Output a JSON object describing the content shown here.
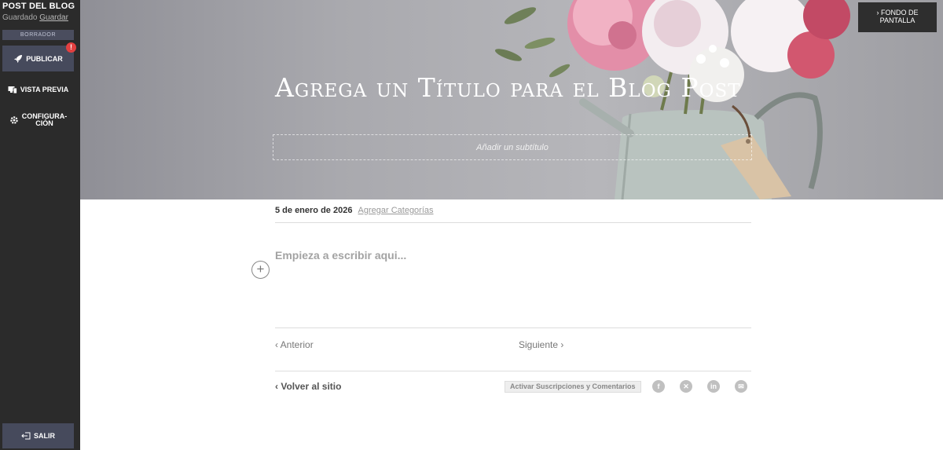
{
  "sidebar": {
    "title": "POST DEL BLOG",
    "saved_text": "Guardado",
    "save_link": "Guardar",
    "draft_label": "BORRADOR",
    "publish_label": "PUBLICAR",
    "publish_badge": "!",
    "preview_label": "VISTA PREVIA",
    "config_label_1": "CONFIGURA-",
    "config_label_2": "CIÓN",
    "exit_label": "SALIR",
    "icons": {
      "publish": "rocket-icon",
      "preview": "monitor-icon",
      "config": "gear-icon",
      "exit": "exit-icon"
    }
  },
  "header": {
    "wallpaper_line1": "› FONDO DE",
    "wallpaper_line2": "PANTALLA",
    "title": "Agrega un Título para el Blog Post",
    "subtitle_placeholder": "Añadir un subtítulo"
  },
  "post": {
    "date": "5 de enero de 2026",
    "categories_link": "Agregar Categorías",
    "editor_placeholder": "Empieza a escribir aqui...",
    "add_block": "+"
  },
  "navigation": {
    "prev": "‹ Anterior",
    "next": "Siguiente ›",
    "back": "‹ Volver al sitio",
    "subscriptions": "Activar Suscripciones y Comentarios"
  },
  "social": {
    "facebook": "f",
    "x": "✕",
    "linkedin": "in",
    "email": "✉"
  },
  "colors": {
    "sidebar_bg": "#2b2b2b",
    "sidebar_button": "#464a5c",
    "badge": "#e34040"
  }
}
